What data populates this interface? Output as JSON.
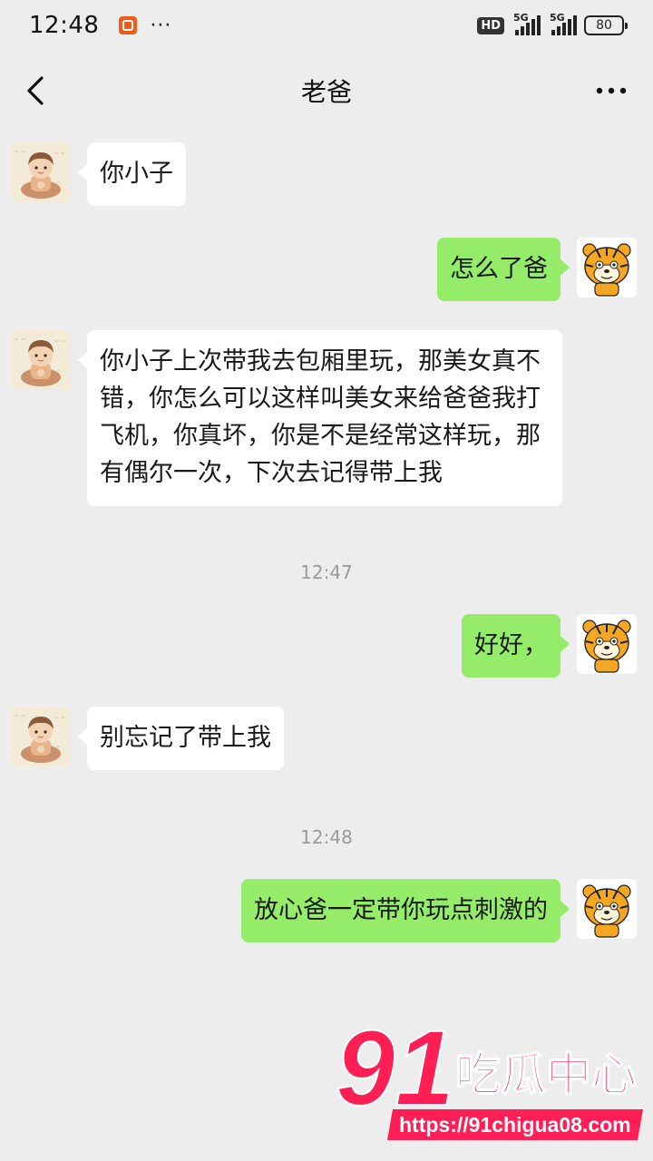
{
  "status_bar": {
    "time": "12:48",
    "more_dots": "···",
    "hd_label": "HD",
    "signal1_label": "5G",
    "signal2_label": "5G",
    "battery": "80"
  },
  "header": {
    "title": "老爸",
    "back_icon": "chevron-left-icon",
    "more_icon": "more-horizontal-icon"
  },
  "messages": [
    {
      "side": "left",
      "text": "你小子"
    },
    {
      "side": "right",
      "text": "怎么了爸"
    },
    {
      "side": "left",
      "text": "你小子上次带我去包厢里玩，那美女真不错，你怎么可以这样叫美女来给爸爸我打飞机，你真坏，你是不是经常这样玩，那有偶尔一次，下次去记得带上我"
    },
    {
      "timestamp": "12:47"
    },
    {
      "side": "right",
      "text": "好好，"
    },
    {
      "side": "left",
      "text": "别忘记了带上我"
    },
    {
      "timestamp": "12:48"
    },
    {
      "side": "right",
      "text": "放心爸一定带你玩点刺激的"
    }
  ],
  "watermark": {
    "number": "91",
    "brand": "吃瓜中心",
    "url": "https://91chigua08.com"
  },
  "colors": {
    "background": "#ededed",
    "bubble_left": "#ffffff",
    "bubble_right": "#95ec69",
    "watermark": "#ff1f55"
  }
}
